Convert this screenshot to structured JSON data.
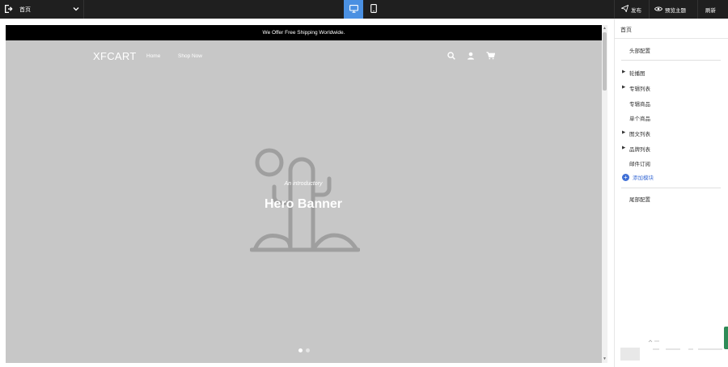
{
  "toolbar": {
    "page_select_value": "首页",
    "publish_label": "发布",
    "preview_label": "预览主题",
    "refresh_label": "刷新"
  },
  "canvas": {
    "announcement": "We Offer Free Shipping Worldwide.",
    "logo": "XFCART",
    "nav": [
      "Home",
      "Shop Now"
    ],
    "hero_subtitle": "An introductory",
    "hero_title": "Hero Banner",
    "slide_count": 2,
    "active_slide": 1
  },
  "panel": {
    "title": "首页",
    "header_config": "头部配置",
    "sections": [
      {
        "label": "轮播图",
        "expandable": true
      },
      {
        "label": "专辑列表",
        "expandable": true
      },
      {
        "label": "专辑商品",
        "expandable": false
      },
      {
        "label": "单个商品",
        "expandable": false
      },
      {
        "label": "图文列表",
        "expandable": true
      },
      {
        "label": "品牌列表",
        "expandable": true
      },
      {
        "label": "邮件订阅",
        "expandable": false
      }
    ],
    "add_block_label": "添加模块",
    "footer_config": "尾部配置"
  },
  "colors": {
    "toolbar_bg": "#1f1f1f",
    "device_active": "#4a90e2",
    "canvas_bg": "#c7c7c7",
    "accent": "#3f6fd6"
  }
}
